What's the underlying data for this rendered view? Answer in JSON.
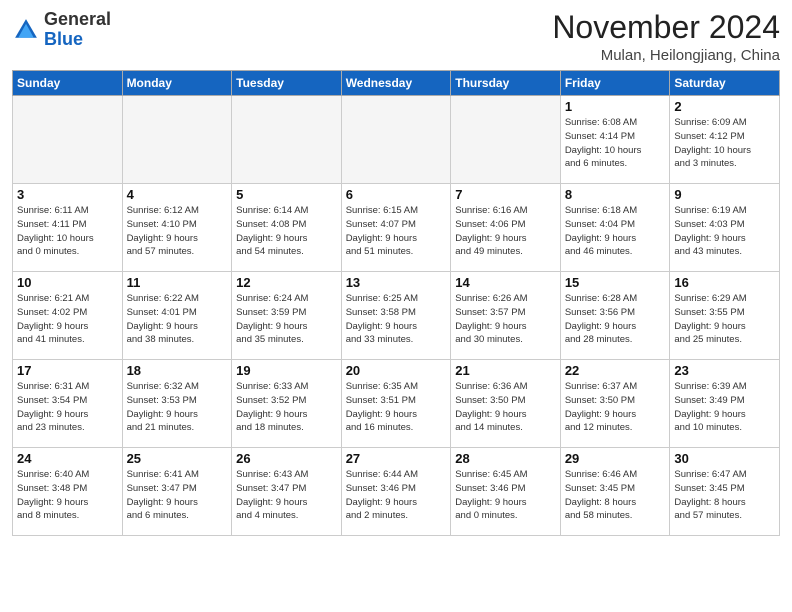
{
  "header": {
    "logo_general": "General",
    "logo_blue": "Blue",
    "month_title": "November 2024",
    "location": "Mulan, Heilongjiang, China"
  },
  "weekdays": [
    "Sunday",
    "Monday",
    "Tuesday",
    "Wednesday",
    "Thursday",
    "Friday",
    "Saturday"
  ],
  "weeks": [
    [
      {
        "day": "",
        "info": ""
      },
      {
        "day": "",
        "info": ""
      },
      {
        "day": "",
        "info": ""
      },
      {
        "day": "",
        "info": ""
      },
      {
        "day": "",
        "info": ""
      },
      {
        "day": "1",
        "info": "Sunrise: 6:08 AM\nSunset: 4:14 PM\nDaylight: 10 hours\nand 6 minutes."
      },
      {
        "day": "2",
        "info": "Sunrise: 6:09 AM\nSunset: 4:12 PM\nDaylight: 10 hours\nand 3 minutes."
      }
    ],
    [
      {
        "day": "3",
        "info": "Sunrise: 6:11 AM\nSunset: 4:11 PM\nDaylight: 10 hours\nand 0 minutes."
      },
      {
        "day": "4",
        "info": "Sunrise: 6:12 AM\nSunset: 4:10 PM\nDaylight: 9 hours\nand 57 minutes."
      },
      {
        "day": "5",
        "info": "Sunrise: 6:14 AM\nSunset: 4:08 PM\nDaylight: 9 hours\nand 54 minutes."
      },
      {
        "day": "6",
        "info": "Sunrise: 6:15 AM\nSunset: 4:07 PM\nDaylight: 9 hours\nand 51 minutes."
      },
      {
        "day": "7",
        "info": "Sunrise: 6:16 AM\nSunset: 4:06 PM\nDaylight: 9 hours\nand 49 minutes."
      },
      {
        "day": "8",
        "info": "Sunrise: 6:18 AM\nSunset: 4:04 PM\nDaylight: 9 hours\nand 46 minutes."
      },
      {
        "day": "9",
        "info": "Sunrise: 6:19 AM\nSunset: 4:03 PM\nDaylight: 9 hours\nand 43 minutes."
      }
    ],
    [
      {
        "day": "10",
        "info": "Sunrise: 6:21 AM\nSunset: 4:02 PM\nDaylight: 9 hours\nand 41 minutes."
      },
      {
        "day": "11",
        "info": "Sunrise: 6:22 AM\nSunset: 4:01 PM\nDaylight: 9 hours\nand 38 minutes."
      },
      {
        "day": "12",
        "info": "Sunrise: 6:24 AM\nSunset: 3:59 PM\nDaylight: 9 hours\nand 35 minutes."
      },
      {
        "day": "13",
        "info": "Sunrise: 6:25 AM\nSunset: 3:58 PM\nDaylight: 9 hours\nand 33 minutes."
      },
      {
        "day": "14",
        "info": "Sunrise: 6:26 AM\nSunset: 3:57 PM\nDaylight: 9 hours\nand 30 minutes."
      },
      {
        "day": "15",
        "info": "Sunrise: 6:28 AM\nSunset: 3:56 PM\nDaylight: 9 hours\nand 28 minutes."
      },
      {
        "day": "16",
        "info": "Sunrise: 6:29 AM\nSunset: 3:55 PM\nDaylight: 9 hours\nand 25 minutes."
      }
    ],
    [
      {
        "day": "17",
        "info": "Sunrise: 6:31 AM\nSunset: 3:54 PM\nDaylight: 9 hours\nand 23 minutes."
      },
      {
        "day": "18",
        "info": "Sunrise: 6:32 AM\nSunset: 3:53 PM\nDaylight: 9 hours\nand 21 minutes."
      },
      {
        "day": "19",
        "info": "Sunrise: 6:33 AM\nSunset: 3:52 PM\nDaylight: 9 hours\nand 18 minutes."
      },
      {
        "day": "20",
        "info": "Sunrise: 6:35 AM\nSunset: 3:51 PM\nDaylight: 9 hours\nand 16 minutes."
      },
      {
        "day": "21",
        "info": "Sunrise: 6:36 AM\nSunset: 3:50 PM\nDaylight: 9 hours\nand 14 minutes."
      },
      {
        "day": "22",
        "info": "Sunrise: 6:37 AM\nSunset: 3:50 PM\nDaylight: 9 hours\nand 12 minutes."
      },
      {
        "day": "23",
        "info": "Sunrise: 6:39 AM\nSunset: 3:49 PM\nDaylight: 9 hours\nand 10 minutes."
      }
    ],
    [
      {
        "day": "24",
        "info": "Sunrise: 6:40 AM\nSunset: 3:48 PM\nDaylight: 9 hours\nand 8 minutes."
      },
      {
        "day": "25",
        "info": "Sunrise: 6:41 AM\nSunset: 3:47 PM\nDaylight: 9 hours\nand 6 minutes."
      },
      {
        "day": "26",
        "info": "Sunrise: 6:43 AM\nSunset: 3:47 PM\nDaylight: 9 hours\nand 4 minutes."
      },
      {
        "day": "27",
        "info": "Sunrise: 6:44 AM\nSunset: 3:46 PM\nDaylight: 9 hours\nand 2 minutes."
      },
      {
        "day": "28",
        "info": "Sunrise: 6:45 AM\nSunset: 3:46 PM\nDaylight: 9 hours\nand 0 minutes."
      },
      {
        "day": "29",
        "info": "Sunrise: 6:46 AM\nSunset: 3:45 PM\nDaylight: 8 hours\nand 58 minutes."
      },
      {
        "day": "30",
        "info": "Sunrise: 6:47 AM\nSunset: 3:45 PM\nDaylight: 8 hours\nand 57 minutes."
      }
    ]
  ]
}
